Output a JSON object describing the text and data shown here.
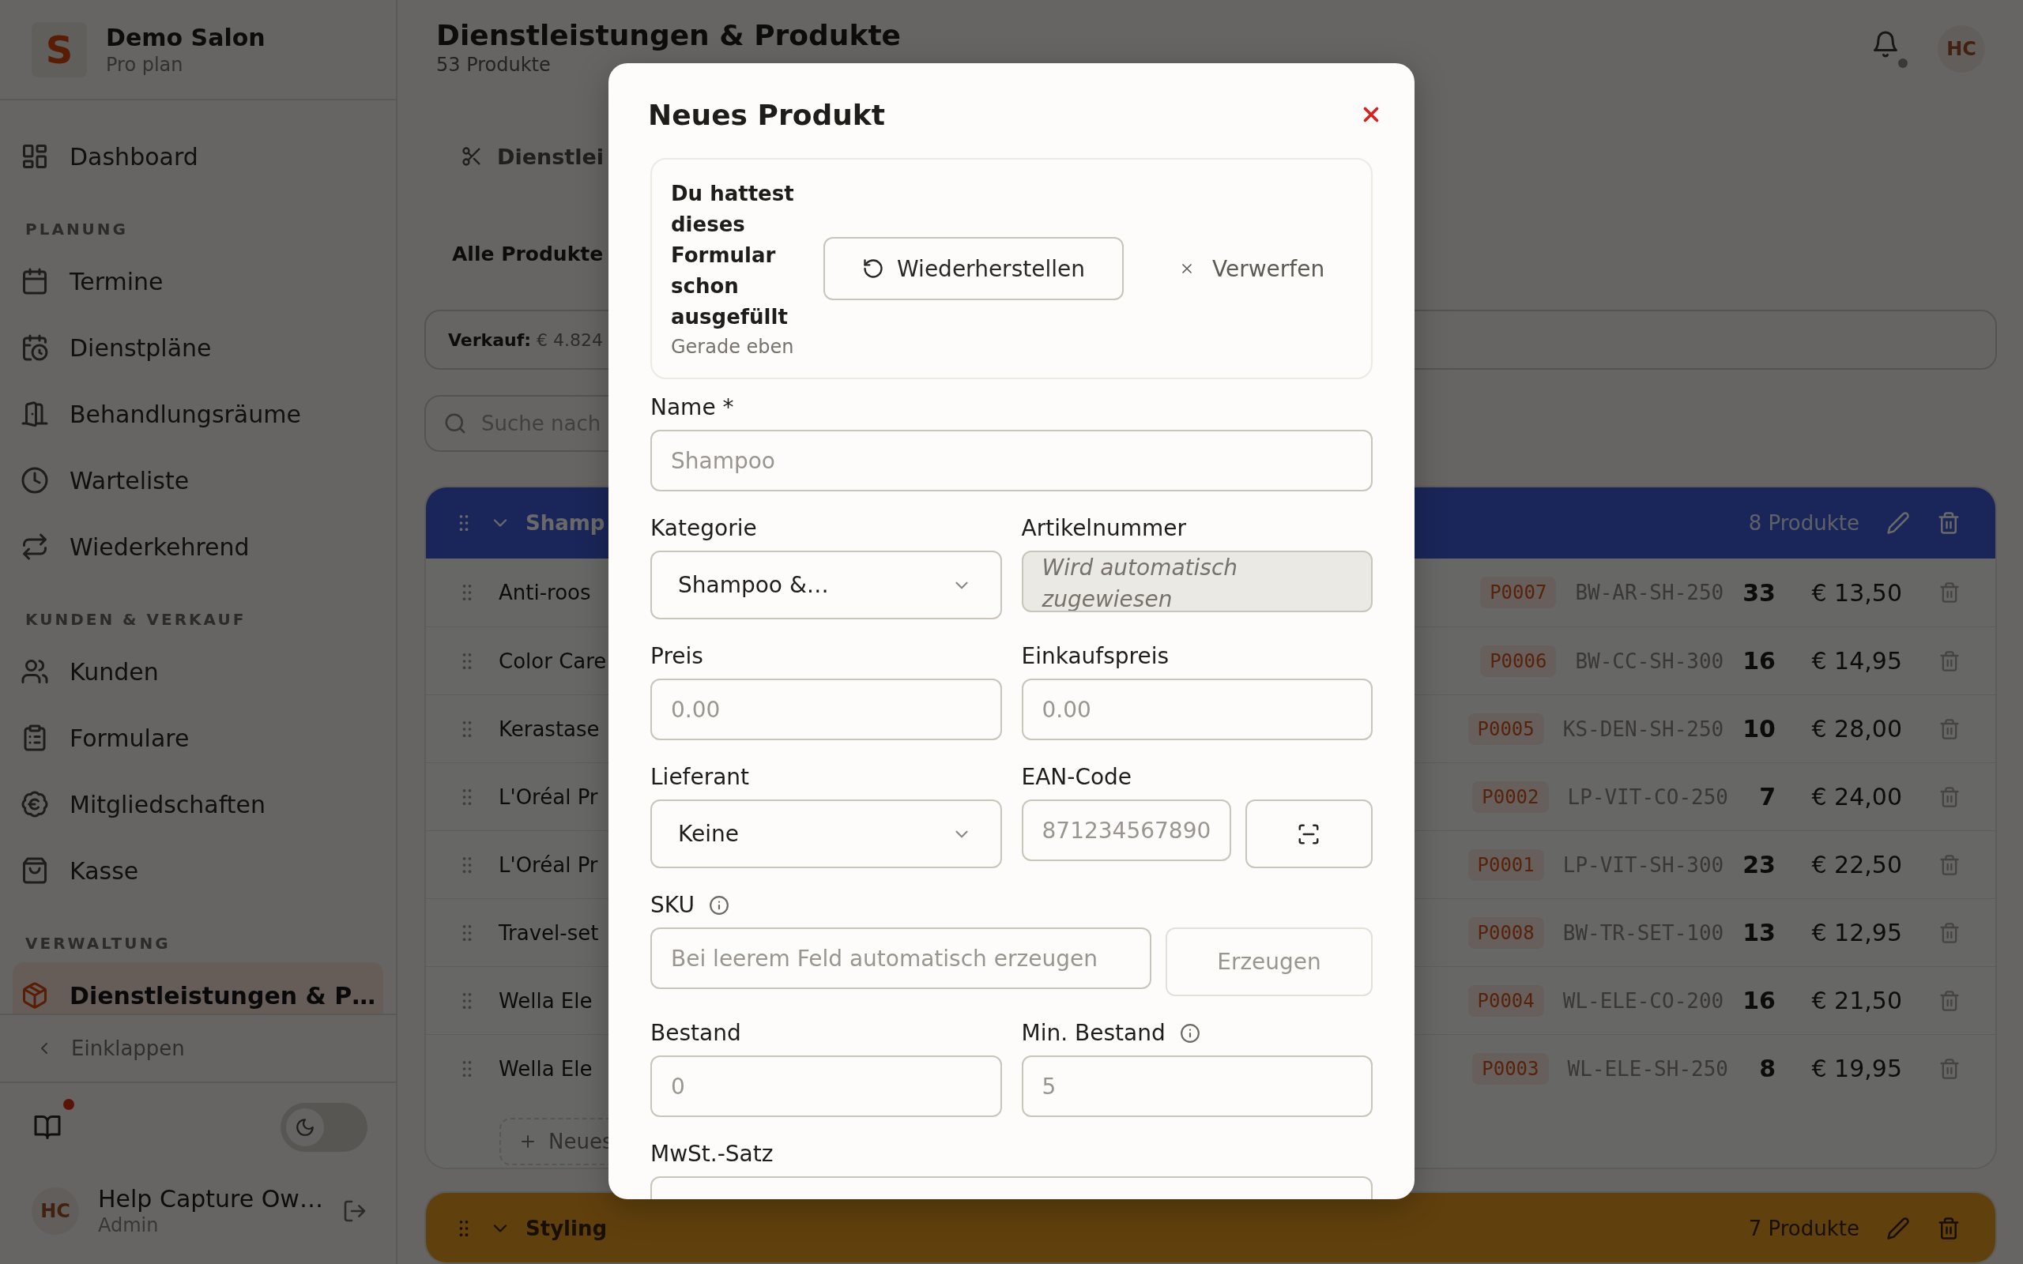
{
  "sidebar": {
    "logo": "S",
    "name": "Demo Salon",
    "plan": "Pro plan",
    "nav": [
      {
        "kind": "item",
        "label": "Dashboard",
        "selected": false
      },
      {
        "kind": "heading",
        "label": "PLANUNG"
      },
      {
        "kind": "item",
        "label": "Termine",
        "selected": false
      },
      {
        "kind": "item",
        "label": "Dienstpläne",
        "selected": false
      },
      {
        "kind": "item",
        "label": "Behandlungsräume",
        "selected": false
      },
      {
        "kind": "item",
        "label": "Warteliste",
        "selected": false
      },
      {
        "kind": "item",
        "label": "Wiederkehrend",
        "selected": false
      },
      {
        "kind": "heading",
        "label": "KUNDEN & VERKAUF"
      },
      {
        "kind": "item",
        "label": "Kunden",
        "selected": false
      },
      {
        "kind": "item",
        "label": "Formulare",
        "selected": false
      },
      {
        "kind": "item",
        "label": "Mitgliedschaften",
        "selected": false
      },
      {
        "kind": "item",
        "label": "Kasse",
        "selected": false
      },
      {
        "kind": "heading",
        "label": "VERWALTUNG"
      },
      {
        "kind": "item",
        "label": "Dienstleistungen & P…",
        "selected": true
      }
    ],
    "collapse": "Einklappen",
    "help_unread": true,
    "dark_mode": false,
    "user": {
      "initials": "HC",
      "name": "Help Capture Ow…",
      "role": "Admin"
    }
  },
  "header": {
    "title": "Dienstleistungen & Produkte",
    "subtitle": "53 Produkte",
    "notification_dot": true,
    "avatar": "HC"
  },
  "main": {
    "tab": "Dienstlei",
    "filter": "Alle Produkte",
    "summary": "**Verkauf:** € 4.824",
    "search": {
      "placeholder": "Suche nach"
    },
    "groups": [
      {
        "name": "Shamp",
        "count": "8 Produkte",
        "color": "#1a2659",
        "expanded": true,
        "add_label": "Neues",
        "rows": [
          {
            "name": "Anti-roos",
            "number": "P0007",
            "sku": "BW-AR-SH-250",
            "stock": "33",
            "price": "€ 13,50"
          },
          {
            "name": "Color Care",
            "number": "P0006",
            "sku": "BW-CC-SH-300",
            "stock": "16",
            "price": "€ 14,95"
          },
          {
            "name": "Kerastase",
            "number": "P0005",
            "sku": "KS-DEN-SH-250",
            "stock": "10",
            "price": "€ 28,00"
          },
          {
            "name": "L'Oréal Pr",
            "number": "P0002",
            "sku": "LP-VIT-CO-250",
            "stock": "7",
            "price": "€ 24,00"
          },
          {
            "name": "L'Oréal Pr",
            "number": "P0001",
            "sku": "LP-VIT-SH-300",
            "stock": "23",
            "price": "€ 22,50"
          },
          {
            "name": "Travel-set",
            "number": "P0008",
            "sku": "BW-TR-SET-100",
            "stock": "13",
            "price": "€ 12,95"
          },
          {
            "name": "Wella Ele",
            "number": "P0004",
            "sku": "WL-ELE-CO-200",
            "stock": "16",
            "price": "€ 21,50"
          },
          {
            "name": "Wella Ele",
            "number": "P0003",
            "sku": "WL-ELE-SH-250",
            "stock": "8",
            "price": "€ 19,95"
          }
        ]
      },
      {
        "name": "Styling",
        "count": "7 Produkte",
        "color": "#5f400d",
        "expanded": true
      }
    ]
  },
  "modal": {
    "title": "Neues Produkt",
    "draft": {
      "message": "Du hattest dieses Formular schon ausgefüllt",
      "time": "Gerade eben",
      "restore": "Wiederherstellen",
      "discard": "Verwerfen"
    },
    "rows": [
      [
        {
          "kind": "text",
          "label": "Name *",
          "placeholder": "Shampoo",
          "info": false,
          "disabled": false
        }
      ],
      [
        {
          "kind": "select",
          "label": "Kategorie",
          "value": "Shampoo &…",
          "info": false,
          "disabled": false
        },
        {
          "kind": "text",
          "label": "Artikelnummer",
          "placeholder": "Wird automatisch zugewiesen",
          "info": false,
          "disabled": true
        }
      ],
      [
        {
          "kind": "text",
          "label": "Preis",
          "placeholder": "0.00",
          "info": false,
          "disabled": false
        },
        {
          "kind": "text",
          "label": "Einkaufspreis",
          "placeholder": "0.00",
          "info": false,
          "disabled": false
        }
      ],
      [
        {
          "kind": "select",
          "label": "Lieferant",
          "value": "Keine",
          "info": false,
          "disabled": false
        },
        {
          "kind": "scan",
          "label": "EAN-Code",
          "placeholder": "871234567890",
          "info": false,
          "disabled": false
        }
      ],
      [
        {
          "kind": "generate",
          "label": "SKU",
          "placeholder": "Bei leerem Feld automatisch erzeugen",
          "button": "Erzeugen",
          "button_disabled": true,
          "info": true,
          "disabled": false
        }
      ],
      [
        {
          "kind": "text",
          "label": "Bestand",
          "placeholder": "0",
          "info": false,
          "disabled": false
        },
        {
          "kind": "text",
          "label": "Min. Bestand",
          "placeholder": "5",
          "info": true,
          "disabled": false
        }
      ],
      [
        {
          "kind": "text",
          "label": "MwSt.-Satz",
          "info": false,
          "disabled": false
        }
      ]
    ]
  }
}
